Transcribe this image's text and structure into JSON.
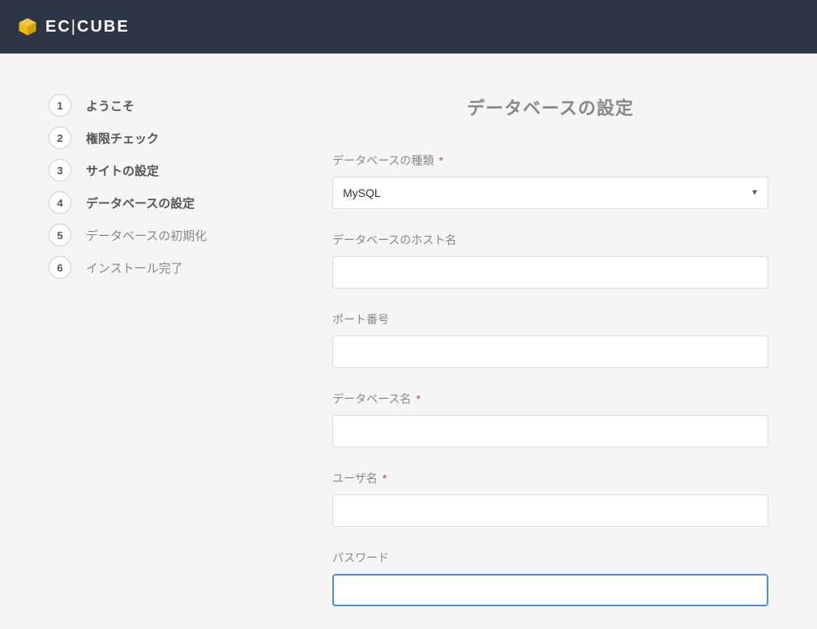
{
  "header": {
    "logo_text_1": "EC",
    "logo_text_2": "CUBE"
  },
  "sidebar": {
    "steps": [
      {
        "num": "1",
        "label": "ようこそ",
        "state": "completed"
      },
      {
        "num": "2",
        "label": "権限チェック",
        "state": "completed"
      },
      {
        "num": "3",
        "label": "サイトの設定",
        "state": "completed"
      },
      {
        "num": "4",
        "label": "データベースの設定",
        "state": "active"
      },
      {
        "num": "5",
        "label": "データベースの初期化",
        "state": "pending"
      },
      {
        "num": "6",
        "label": "インストール完了",
        "state": "pending"
      }
    ]
  },
  "main": {
    "title": "データベースの設定",
    "fields": {
      "db_type": {
        "label": "データベースの種類",
        "required": true,
        "value": "MySQL"
      },
      "db_host": {
        "label": "データベースのホスト名",
        "required": false,
        "value": ""
      },
      "port": {
        "label": "ポート番号",
        "required": false,
        "value": ""
      },
      "db_name": {
        "label": "データベース名",
        "required": true,
        "value": ""
      },
      "username": {
        "label": "ユーザ名",
        "required": true,
        "value": ""
      },
      "password": {
        "label": "パスワード",
        "required": false,
        "value": ""
      }
    },
    "required_marker": "*"
  }
}
